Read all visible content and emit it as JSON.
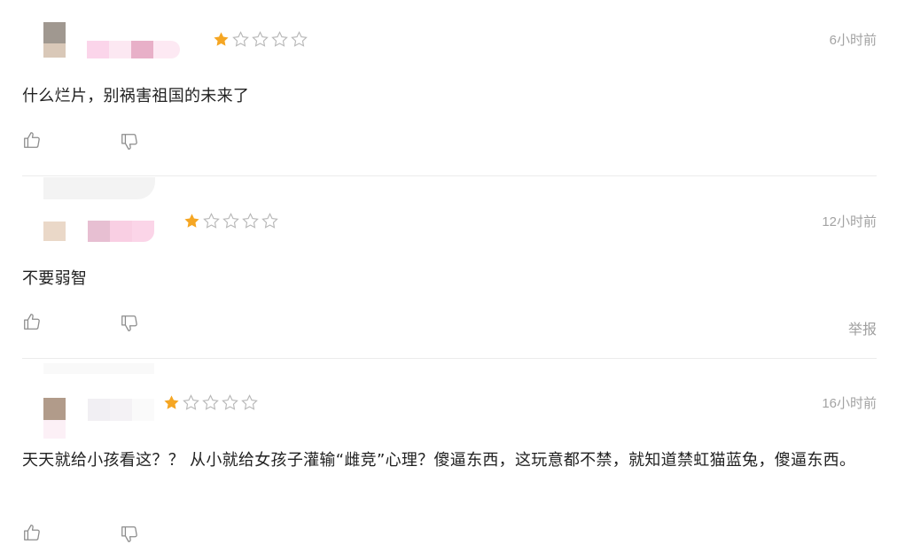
{
  "reviews": [
    {
      "rating": 1,
      "max_rating": 5,
      "time": "6小时前",
      "text": "什么烂片，别祸害祖国的未来了",
      "report_label": ""
    },
    {
      "rating": 1,
      "max_rating": 5,
      "time": "12小时前",
      "text": "不要弱智",
      "report_label": "举报"
    },
    {
      "rating": 1,
      "max_rating": 5,
      "time": "16小时前",
      "text": "天天就给小孩看这？？ 从小就给女孩子灌输“雌竞”心理？傻逼东西，这玩意都不禁，就知道禁虹猫蓝兔，傻逼东西。",
      "report_label": ""
    }
  ],
  "icons": {
    "like": "thumbs-up-icon",
    "dislike": "thumbs-down-icon",
    "star_filled": "star-filled-icon",
    "star_empty": "star-empty-icon"
  },
  "colors": {
    "star_filled": "#f5a623",
    "star_empty": "#c8c8c8",
    "time": "#a3a3a3",
    "icon": "#8c8c8c"
  }
}
